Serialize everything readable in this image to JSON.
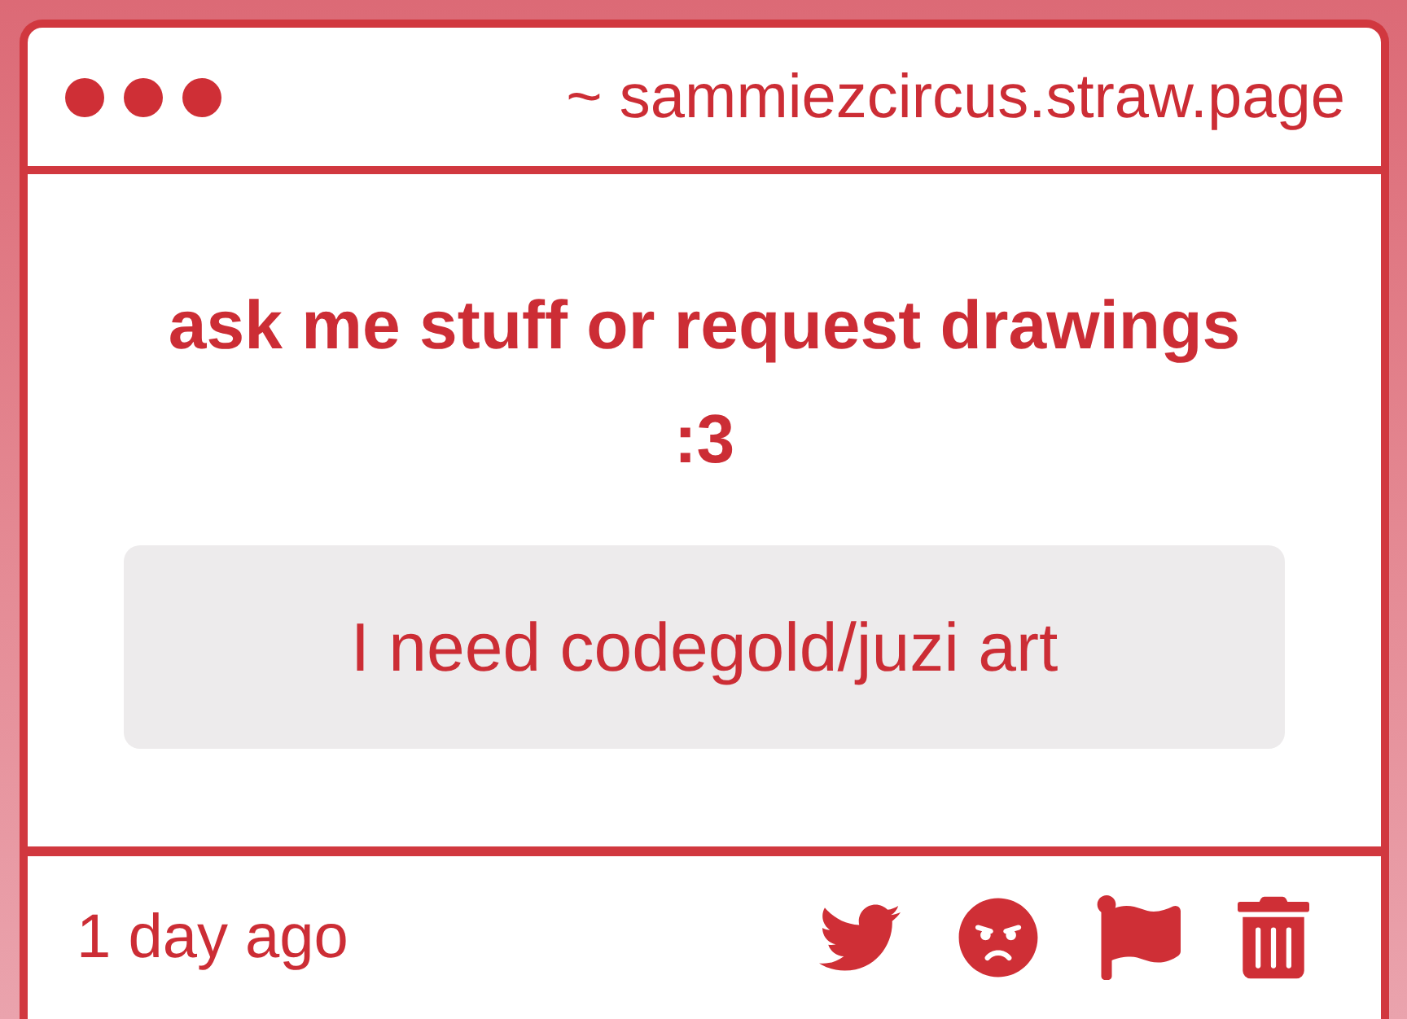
{
  "window": {
    "address": "~ sammiezcircus.straw.page"
  },
  "prompt": {
    "title": "ask me stuff or request drawings :3"
  },
  "question": {
    "text": "I need codegold/juzi art"
  },
  "footer": {
    "time": "1 day ago",
    "actions": [
      {
        "kind": "share"
      },
      {
        "kind": "react"
      },
      {
        "kind": "report"
      },
      {
        "kind": "delete"
      }
    ]
  }
}
